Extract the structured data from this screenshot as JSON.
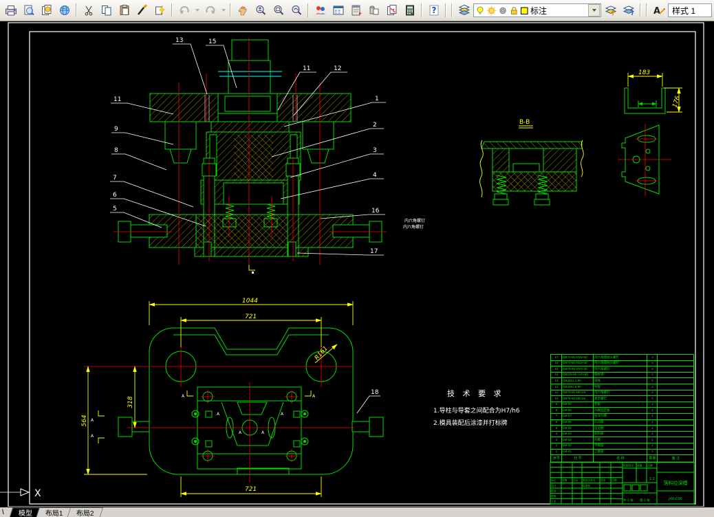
{
  "toolbar": {
    "layer_value": "标注",
    "style_value": "样式 1",
    "icon_names": [
      "plot-icon",
      "preview-icon",
      "publish-icon",
      "web-icon",
      "cut-icon",
      "copy-icon",
      "paste-icon",
      "match-properties-icon",
      "property-paint-icon",
      "undo-icon",
      "redo-icon",
      "pan-icon",
      "zoom-realtime-icon",
      "zoom-window-icon",
      "zoom-previous-icon",
      "redline-icon",
      "designcenter-icon",
      "tool-palettes-icon",
      "sheetset-icon",
      "markup-icon",
      "quickcalc-icon",
      "help-icon",
      "layers-icon",
      "bulb-icon",
      "sun-icon",
      "gear-icon",
      "lock-icon",
      "color-swatch-icon",
      "make-layer-current-icon",
      "layer-previous-icon",
      "text-style-icon"
    ]
  },
  "drawing": {
    "front_callouts": [
      "13",
      "15",
      "11",
      "12",
      "11",
      "1",
      "9",
      "2",
      "8",
      "3",
      "7",
      "4",
      "6",
      "5",
      "16",
      "17"
    ],
    "front_note": [
      "内六角螺钉",
      "内六角螺钉"
    ],
    "section_label": "B-B",
    "section_marks": "A",
    "plan_callout": "18",
    "dims": {
      "plan_width": "1044",
      "plan_inner_top": "721",
      "plan_inner_bottom": "721",
      "plan_height": "564",
      "plan_offset": "318",
      "plan_radius": "R161",
      "bracket_width": "183",
      "bracket_height": "176"
    },
    "tech_req": {
      "title": "技 术 要 求",
      "items": [
        "1.导柱与导套之间配合为H7/h6",
        "2.模具装配后涂漆并打标牌"
      ]
    },
    "ucs_axis": "X"
  },
  "bom": {
    "header": [
      "序号",
      "代  号",
      "名  称",
      "数量",
      "备 注"
    ],
    "rows": [
      {
        "no": "17",
        "code": "GB70-85 M16×60",
        "name": "内六角圆柱头螺钉",
        "qty": "4",
        "note": ""
      },
      {
        "no": "16",
        "code": "GB70-85 M12×45",
        "name": "内六角圆柱头螺钉",
        "qty": "4",
        "note": ""
      },
      {
        "no": "15",
        "code": "GB70-85 M10×35",
        "name": "内六角螺钉",
        "qty": "6",
        "note": ""
      },
      {
        "no": "14",
        "code": "GB119-86 A10×60",
        "name": "圆柱销",
        "qty": "2",
        "note": ""
      },
      {
        "no": "13",
        "code": "GB2861.1-90",
        "name": "导柱",
        "qty": "2",
        "note": ""
      },
      {
        "no": "12",
        "code": "GB2861.6-90",
        "name": "导套",
        "qty": "2",
        "note": ""
      },
      {
        "no": "11",
        "code": "GB70-85 M8×25",
        "name": "内六角螺钉",
        "qty": "4",
        "note": ""
      },
      {
        "no": "10",
        "code": "GB78-85 M6×10",
        "name": "紧定螺钉",
        "qty": "2",
        "note": ""
      },
      {
        "no": "9",
        "code": "LM-09",
        "name": "垫板",
        "qty": "1",
        "note": ""
      },
      {
        "no": "8",
        "code": "LM-08",
        "name": "凸模固定板",
        "qty": "1",
        "note": ""
      },
      {
        "no": "7",
        "code": "LM-07",
        "name": "拉深凸模",
        "qty": "1",
        "note": ""
      },
      {
        "no": "6",
        "code": "LM-06",
        "name": "凸凹模",
        "qty": "1",
        "note": ""
      },
      {
        "no": "5",
        "code": "LM-05",
        "name": "压边圈",
        "qty": "1",
        "note": ""
      },
      {
        "no": "4",
        "code": "LM-04",
        "name": "卸料板",
        "qty": "1",
        "note": ""
      },
      {
        "no": "3",
        "code": "LM-03",
        "name": "凹模",
        "qty": "1",
        "note": ""
      },
      {
        "no": "2",
        "code": "LM-02",
        "name": "下模座",
        "qty": "1",
        "note": ""
      },
      {
        "no": "1",
        "code": "LM-01",
        "name": "上模座",
        "qty": "1",
        "note": ""
      }
    ]
  },
  "title_block": {
    "change_row": [
      "标记",
      "处数",
      "分区",
      "更改文件号",
      "签名",
      "日期"
    ],
    "sign_rows": [
      "设计",
      "校对",
      "审核",
      "工艺"
    ],
    "std_label": "标准化",
    "stage_label": "阶段标记",
    "mass_label": "质量",
    "scale_label": "比例",
    "scale_value": "1:2",
    "sheet_total": "共 1 张",
    "sheet_no": "第 1 张",
    "title": "落料拉深模",
    "drawing_no": "JX0-C00"
  },
  "tabs": [
    {
      "label": "模型"
    },
    {
      "label": "布局1"
    },
    {
      "label": "布局2"
    }
  ]
}
